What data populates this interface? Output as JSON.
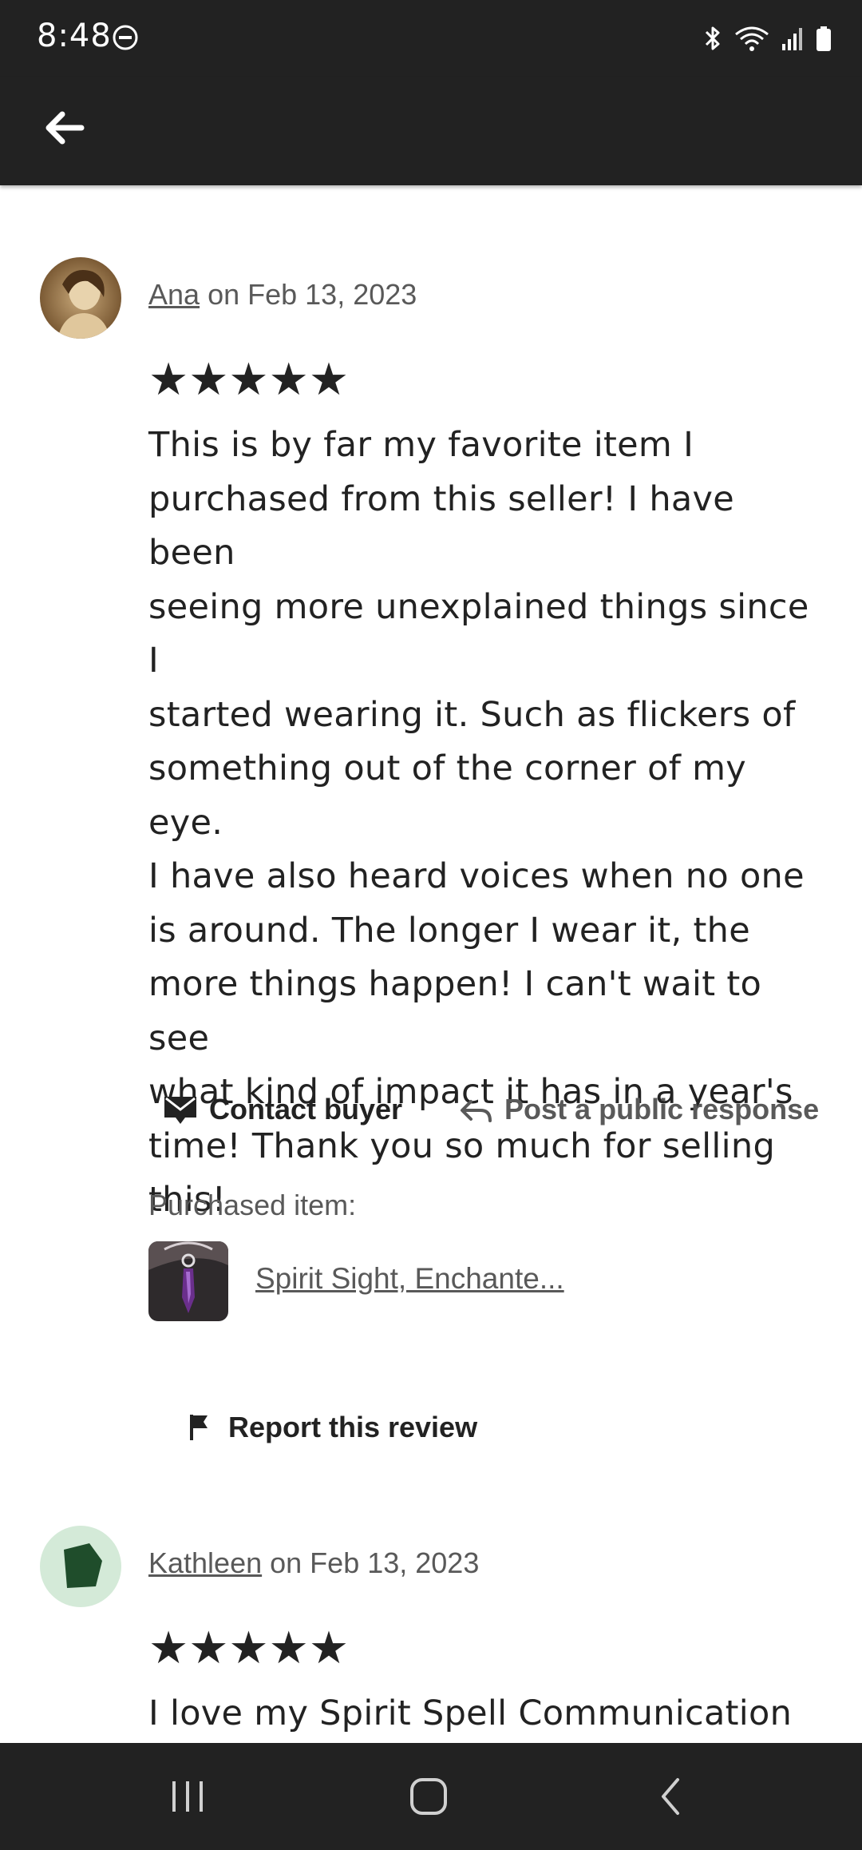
{
  "status_bar": {
    "time": "8:48",
    "icons": [
      "do-not-disturb-icon",
      "bluetooth-icon",
      "wifi-icon",
      "signal-icon",
      "battery-icon"
    ]
  },
  "app_bar": {
    "back_icon": "arrow-left-icon"
  },
  "reviews": [
    {
      "reviewer": "Ana",
      "date_text": "on Feb 13, 2023",
      "rating": 5,
      "stars": "★★★★★",
      "text": "This is by far my favorite item I purchased from this seller! I have been seeing more unexplained things since I started wearing it. Such as flickers of something out of the corner of my eye. I have also heard voices when no one is around. The longer I wear it, the more things happen! I can't wait to see what kind of impact it has in a year's time! Thank you so much for selling this!",
      "text_lines": [
        "This is by far my favorite item I",
        "purchased from this seller! I have been",
        "seeing more unexplained things since I",
        "started wearing it. Such as flickers of",
        "something out of the corner of my eye.",
        "I have also heard voices when no one",
        "is around. The longer I wear it, the",
        "more things happen! I can't wait to see",
        "what kind of impact it has in a year's",
        "time! Thank you so much for selling",
        "this!"
      ],
      "contact_label": "Contact buyer",
      "post_label": "Post a public response",
      "purchased_label": "Purchased item:",
      "item_title": "Spirit Sight, Enchante...",
      "report_label": "Report this review"
    },
    {
      "reviewer": "Kathleen",
      "date_text": "on Feb 13, 2023",
      "rating": 5,
      "stars": "★★★★★",
      "text_lines": [
        "I love my Spirit Spell Communication"
      ]
    }
  ],
  "colors": {
    "bar_background": "#222222",
    "text_primary": "#222222",
    "text_secondary": "#595959",
    "avatar_green_bg": "#d4ead8",
    "avatar_green_shape": "#1f4d2b"
  },
  "nav_bar": {
    "icons": [
      "recent-apps-icon",
      "home-icon",
      "back-nav-icon"
    ]
  }
}
